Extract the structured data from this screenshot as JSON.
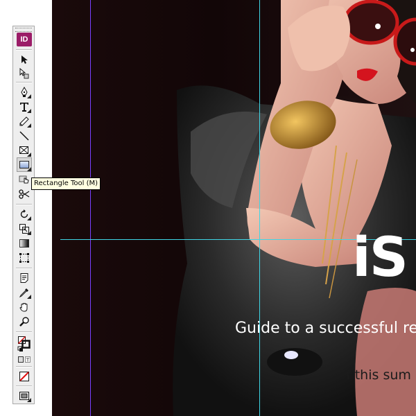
{
  "app": {
    "badge": "ID"
  },
  "tooltip": {
    "text": "Rectangle Tool (M)"
  },
  "document": {
    "headline": "iS",
    "tagline": "Guide to a successful re",
    "subline": "f this sum"
  },
  "tools": [
    {
      "name": "selection-tool",
      "icon": "arrow-icon"
    },
    {
      "name": "direct-selection-tool",
      "icon": "hand-arrow-icon"
    },
    {
      "name": "pen-tool",
      "icon": "pen-icon"
    },
    {
      "name": "type-tool",
      "icon": "type-icon"
    },
    {
      "name": "pencil-tool",
      "icon": "pencil-icon"
    },
    {
      "name": "line-tool",
      "icon": "line-icon"
    },
    {
      "name": "rectangle-frame-tool",
      "icon": "frame-icon"
    },
    {
      "name": "rectangle-tool",
      "icon": "rectangle-icon",
      "selected": true
    },
    {
      "name": "button-tool",
      "icon": "hand-cursor-icon"
    },
    {
      "name": "scissors-tool",
      "icon": "scissors-icon"
    },
    {
      "name": "rotate-tool",
      "icon": "rotate-icon"
    },
    {
      "name": "scale-tool",
      "icon": "scale-icon"
    },
    {
      "name": "gradient-tool",
      "icon": "gradient-icon"
    },
    {
      "name": "free-transform-tool",
      "icon": "transform-icon"
    },
    {
      "name": "note-tool",
      "icon": "note-icon"
    },
    {
      "name": "eyedropper-tool",
      "icon": "eyedropper-icon"
    },
    {
      "name": "hand-tool",
      "icon": "hand-icon"
    },
    {
      "name": "zoom-tool",
      "icon": "zoom-icon"
    },
    {
      "name": "fill-stroke-swatch",
      "icon": "fill-stroke-icon"
    },
    {
      "name": "formatting-affects",
      "icon": "formatting-icon"
    },
    {
      "name": "apply-none",
      "icon": "none-icon"
    },
    {
      "name": "view-mode",
      "icon": "view-mode-icon"
    }
  ],
  "colors": {
    "guide_purple": "#7a40ff",
    "guide_cyan": "#3fd6e6",
    "badge": "#9b1d68",
    "tooltip_bg": "#ffffe1"
  }
}
